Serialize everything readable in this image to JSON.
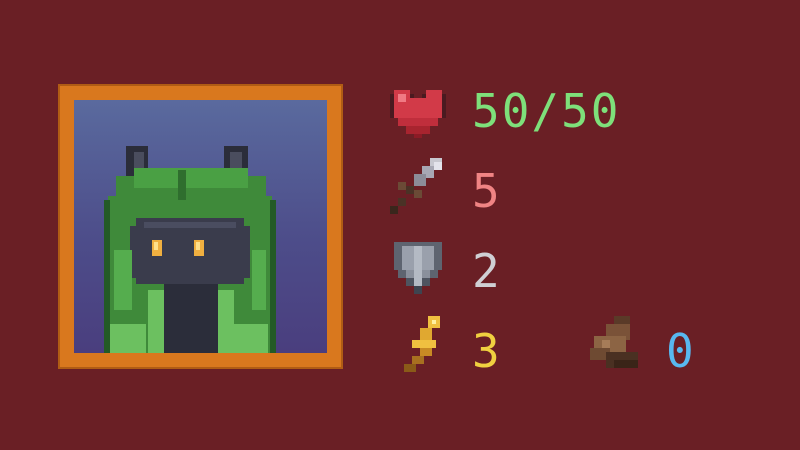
{
  "character": {
    "portrait_icon": "hooded-cat-portrait"
  },
  "stats": {
    "health": {
      "icon": "heart-icon",
      "value": "50/50",
      "color": "#7ee07a"
    },
    "attack": {
      "icon": "sword-icon",
      "value": "5",
      "color": "#f08484"
    },
    "defense": {
      "icon": "shield-icon",
      "value": "2",
      "color": "#cfcfd4"
    },
    "energy": {
      "icon": "lightning-icon",
      "value": "3",
      "color": "#f0d040"
    },
    "resource": {
      "icon": "boot-icon",
      "value": "0",
      "color": "#58b8f0"
    }
  },
  "colors": {
    "background": "#6a1f25",
    "frame": "#d9781e"
  }
}
